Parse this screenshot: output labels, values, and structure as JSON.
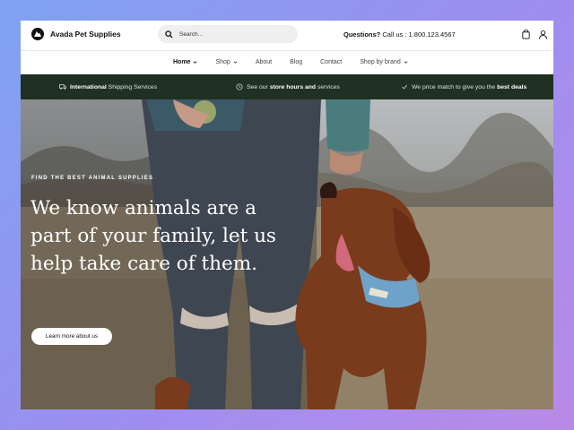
{
  "header": {
    "brand": "Avada Pet Supplies",
    "search_placeholder": "Search...",
    "questions_label": "Questions?",
    "questions_text": "Call us : 1.800.123.4567"
  },
  "nav": {
    "items": [
      {
        "label": "Home",
        "dropdown": true,
        "active": true
      },
      {
        "label": "Shop",
        "dropdown": true
      },
      {
        "label": "About"
      },
      {
        "label": "Blog"
      },
      {
        "label": "Contact"
      },
      {
        "label": "Shop by brand",
        "dropdown": true
      }
    ]
  },
  "infobar": {
    "shipping_bold": "International",
    "shipping_rest": " Shipping Services",
    "store_pre": "See our ",
    "store_bold": "store hours and",
    "store_post": " services",
    "price_pre": "We price match to give you the ",
    "price_bold": "best deals"
  },
  "hero": {
    "eyebrow": "FIND THE BEST ANIMAL SUPPLIES",
    "headline": "We know animals are a part of your family, let us help take care of them.",
    "cta": "Learn more about us"
  },
  "colors": {
    "infobar_bg": "#203022",
    "page_bg_gradient": [
      "#7fa3f0",
      "#b98ae8"
    ]
  },
  "icons": [
    "logo-mark-icon",
    "search-icon",
    "cart-icon",
    "user-icon",
    "chevron-down-icon",
    "truck-icon",
    "clock-icon",
    "check-icon"
  ]
}
